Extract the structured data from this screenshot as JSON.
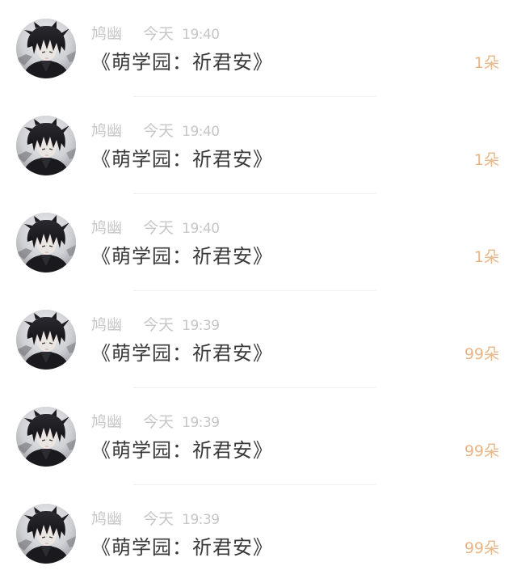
{
  "messages": [
    {
      "sender": "鸠幽",
      "date": "今天",
      "time": "19:40",
      "text": "《萌学园：祈君安》",
      "gift": "1朵"
    },
    {
      "sender": "鸠幽",
      "date": "今天",
      "time": "19:40",
      "text": "《萌学园：祈君安》",
      "gift": "1朵"
    },
    {
      "sender": "鸠幽",
      "date": "今天",
      "time": "19:40",
      "text": "《萌学园：祈君安》",
      "gift": "1朵"
    },
    {
      "sender": "鸠幽",
      "date": "今天",
      "time": "19:39",
      "text": "《萌学园：祈君安》",
      "gift": "99朵"
    },
    {
      "sender": "鸠幽",
      "date": "今天",
      "time": "19:39",
      "text": "《萌学园：祈君安》",
      "gift": "99朵"
    },
    {
      "sender": "鸠幽",
      "date": "今天",
      "time": "19:39",
      "text": "《萌学园：祈君安》",
      "gift": "99朵"
    }
  ],
  "colors": {
    "sender_meta": "#c6c6c6",
    "message_text": "#3a3a3a",
    "gift_count": "#e8b587",
    "divider": "#f0f0f0"
  },
  "icons": {
    "avatar": "user-avatar-dark-hair"
  }
}
